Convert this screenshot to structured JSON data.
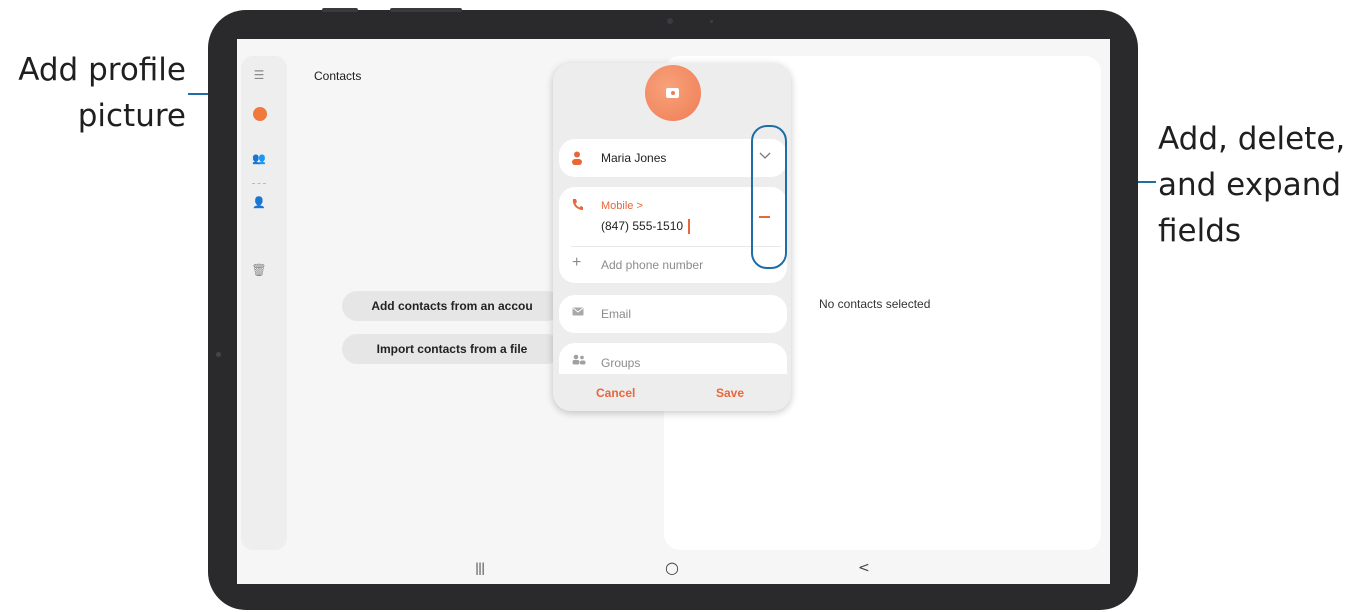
{
  "callouts": {
    "left_line1": "Add profile",
    "left_line2": "picture",
    "right_line1": "Add, delete,",
    "right_line2": "and expand",
    "right_line3": "fields"
  },
  "app": {
    "title": "Contacts",
    "sidebar": [
      "menu-icon",
      "account-icon",
      "groups-icon",
      "manage-contacts-icon",
      "trash-icon"
    ],
    "buttons": {
      "add_from_account": "Add contacts from an accou",
      "import_from_file": "Import contacts from a file"
    },
    "right_panel_message": "No contacts selected"
  },
  "dialog": {
    "name": "Maria Jones",
    "phone_label": "Mobile >",
    "phone_value": "(847) 555-1510",
    "add_phone_placeholder": "Add phone number",
    "email_placeholder": "Email",
    "groups_placeholder": "Groups",
    "cancel": "Cancel",
    "save": "Save"
  },
  "navbar": {
    "recents": "|||",
    "home": "○",
    "back": "<"
  },
  "colors": {
    "accent": "#e8663a",
    "callout_line": "#1f6da6",
    "bezel": "#2a2a2c"
  }
}
